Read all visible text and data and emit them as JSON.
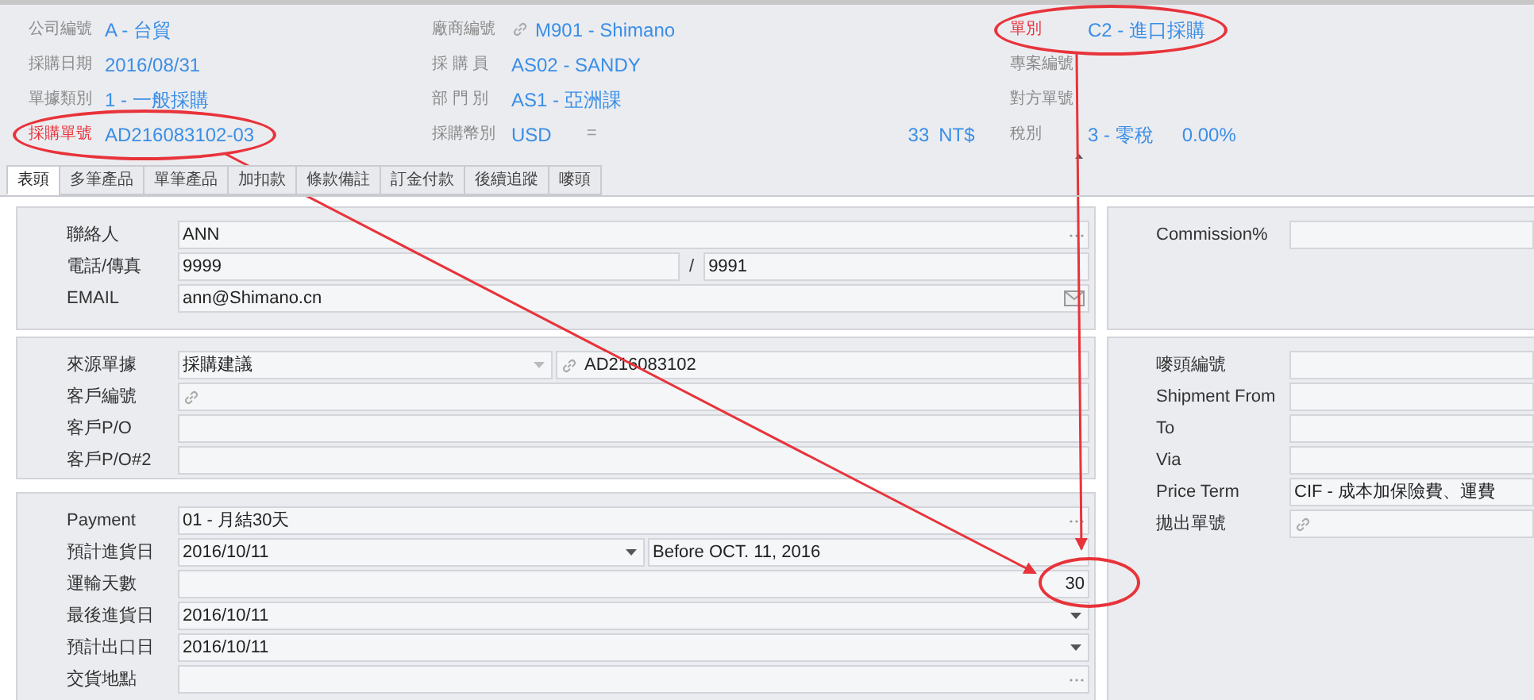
{
  "header": {
    "rows": [
      [
        {
          "label": "公司編號",
          "value": "A - 台貿",
          "annotated": false
        },
        {
          "label": "廠商編號",
          "value": "M901 - Shimano",
          "link": true
        },
        {
          "label": "單別",
          "value": "C2 - 進口採購",
          "annotated": true
        }
      ],
      [
        {
          "label": "採購日期",
          "value": "2016/08/31",
          "annotated": false
        },
        {
          "label": "採 購 員",
          "value": "AS02 - SANDY"
        },
        {
          "label": "專案編號",
          "annotated": false
        }
      ],
      [
        {
          "label": "單據類別",
          "value": "1 - 一般採購",
          "annotated": false
        },
        {
          "label": "部 門 別",
          "value": "AS1 - 亞洲課"
        },
        {
          "label": "對方單號",
          "annotated": false
        }
      ],
      [
        {
          "label": "採購單號",
          "value": "AD216083102-03",
          "annotated": true
        },
        {
          "label": "採購幣別",
          "value": "USD",
          "equals": "=",
          "rate": "33",
          "currency": "NT$"
        },
        {
          "label": "稅別",
          "value": "3 - 零稅",
          "rate": "0.00%",
          "annotated": false
        }
      ]
    ]
  },
  "tabs": [
    {
      "label": "表頭",
      "selected": true
    },
    {
      "label": "多筆產品",
      "selected": false
    },
    {
      "label": "單筆產品",
      "selected": false
    },
    {
      "label": "加扣款",
      "selected": false
    },
    {
      "label": "條款備註",
      "selected": false
    },
    {
      "label": "訂金付款",
      "selected": false
    },
    {
      "label": "後續追蹤",
      "selected": false
    },
    {
      "label": "嘜頭",
      "selected": false
    }
  ],
  "left_groups": [
    [
      {
        "label": "聯絡人",
        "kind": "ellipsis",
        "value": "ANN"
      },
      {
        "label": "電話/傳真",
        "kind": "phone",
        "value": "9999",
        "separator": "/",
        "fax": "9991"
      },
      {
        "label": "EMAIL",
        "kind": "email",
        "value": "ann@Shimano.cn"
      }
    ],
    [
      {
        "label": "來源單據",
        "kind": "source",
        "value": "採購建議",
        "link_value": "AD216083102"
      },
      {
        "label": "客戶編號",
        "kind": "link"
      },
      {
        "label": "客戶P/O",
        "kind": "text"
      },
      {
        "label": "客戶P/O#2",
        "kind": "text"
      }
    ],
    [
      {
        "label": "Payment",
        "kind": "ellipsis",
        "value": "01 - 月結30天"
      },
      {
        "label": "預計進貨日",
        "kind": "date_note",
        "value": "2016/10/11",
        "note": "Before OCT. 11, 2016"
      },
      {
        "label": "運輸天數",
        "kind": "number",
        "value": "30",
        "annotated": true
      },
      {
        "label": "最後進貨日",
        "kind": "dropdown",
        "value": "2016/10/11"
      },
      {
        "label": "預計出口日",
        "kind": "dropdown",
        "value": "2016/10/11"
      },
      {
        "label": "交貨地點",
        "kind": "ellipsis"
      }
    ]
  ],
  "right_groups": [
    [
      {
        "label": "Commission%",
        "kind": "text"
      }
    ],
    [
      {
        "label": "嘜頭編號",
        "kind": "text"
      },
      {
        "label": "Shipment From",
        "kind": "text"
      },
      {
        "label": "To",
        "kind": "text"
      },
      {
        "label": "Via",
        "kind": "text"
      },
      {
        "label": "Price Term",
        "kind": "text",
        "value": "CIF - 成本加保險費、運費"
      },
      {
        "label": "拋出單號",
        "kind": "link"
      }
    ]
  ]
}
